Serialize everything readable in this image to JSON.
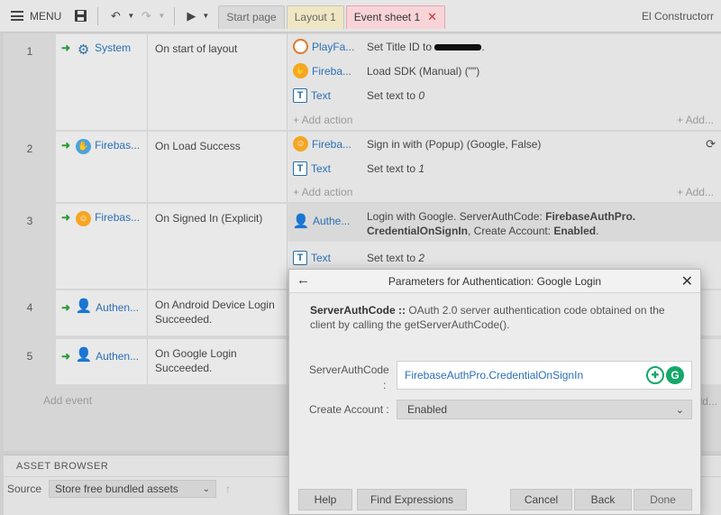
{
  "toolbar": {
    "menu_label": "MENU",
    "tabs": [
      {
        "label": "Start page"
      },
      {
        "label": "Layout 1"
      },
      {
        "label": "Event sheet 1"
      }
    ],
    "project_name": "El Constructorr"
  },
  "events": [
    {
      "number": "1",
      "condition_object": "System",
      "condition_icon": "gear-icon",
      "condition_text": "On start of layout",
      "actions": [
        {
          "object": "PlayFa...",
          "icon": "playfab-icon",
          "text": "Set Title ID to "
        },
        {
          "object": "Fireba...",
          "icon": "firebase-icon",
          "text": "Load SDK (Manual) (\"\")"
        },
        {
          "object": "Text",
          "icon": "text-icon",
          "text": "Set text to ",
          "value": "0"
        }
      ]
    },
    {
      "number": "2",
      "condition_object": "Firebas...",
      "condition_icon": "firebase-icon",
      "condition_text": "On Load Success",
      "actions": [
        {
          "object": "Fireba...",
          "icon": "firebase-auth-icon",
          "text": "Sign in with (Popup) (Google, False)"
        },
        {
          "object": "Text",
          "icon": "text-icon",
          "text": "Set text to ",
          "value": "1"
        }
      ]
    },
    {
      "number": "3",
      "condition_object": "Firebas...",
      "condition_icon": "firebase-auth-icon",
      "condition_text": "On Signed In (Explicit)",
      "actions": [
        {
          "object": "Authe...",
          "icon": "person-lock-icon",
          "text_prefix": "Login with Google. ServerAuthCode: ",
          "text_bold1": "FirebaseAuthPro.",
          "text_bold2": "CredentialOnSignIn",
          "text_mid": ", Create Account: ",
          "text_bold3": "Enabled",
          "text_end": "."
        },
        {
          "object": "Text",
          "icon": "text-icon",
          "text": "Set text to ",
          "value": "2"
        }
      ]
    },
    {
      "number": "4",
      "condition_object": "Authen...",
      "condition_icon": "person-lock-icon",
      "condition_text": "On Android Device Login Succeeded."
    },
    {
      "number": "5",
      "condition_object": "Authen...",
      "condition_icon": "person-lock-icon",
      "condition_text": "On Google Login Succeeded."
    }
  ],
  "sheet": {
    "add_action": "+ Add action",
    "add_more": "+ Add...",
    "add_more_short": "+ Add...",
    "add_event": "Add event"
  },
  "asset_browser": {
    "title": "ASSET BROWSER",
    "source_label": "Source",
    "source_value": "Store free bundled assets"
  },
  "dialog": {
    "title": "Parameters for Authentication: Google Login",
    "desc_bold": "ServerAuthCode ::",
    "desc_text": " OAuth 2.0 server authentication code obtained on the client by calling the getServerAuthCode().",
    "param1_label": "ServerAuthCode",
    "param1_colon": ":",
    "param1_value": "FirebaseAuthPro.CredentialOnSignIn",
    "param2_label": "Create Account :",
    "param2_value": "Enabled",
    "buttons": {
      "help": "Help",
      "find": "Find Expressions",
      "cancel": "Cancel",
      "back": "Back",
      "done": "Done"
    }
  }
}
